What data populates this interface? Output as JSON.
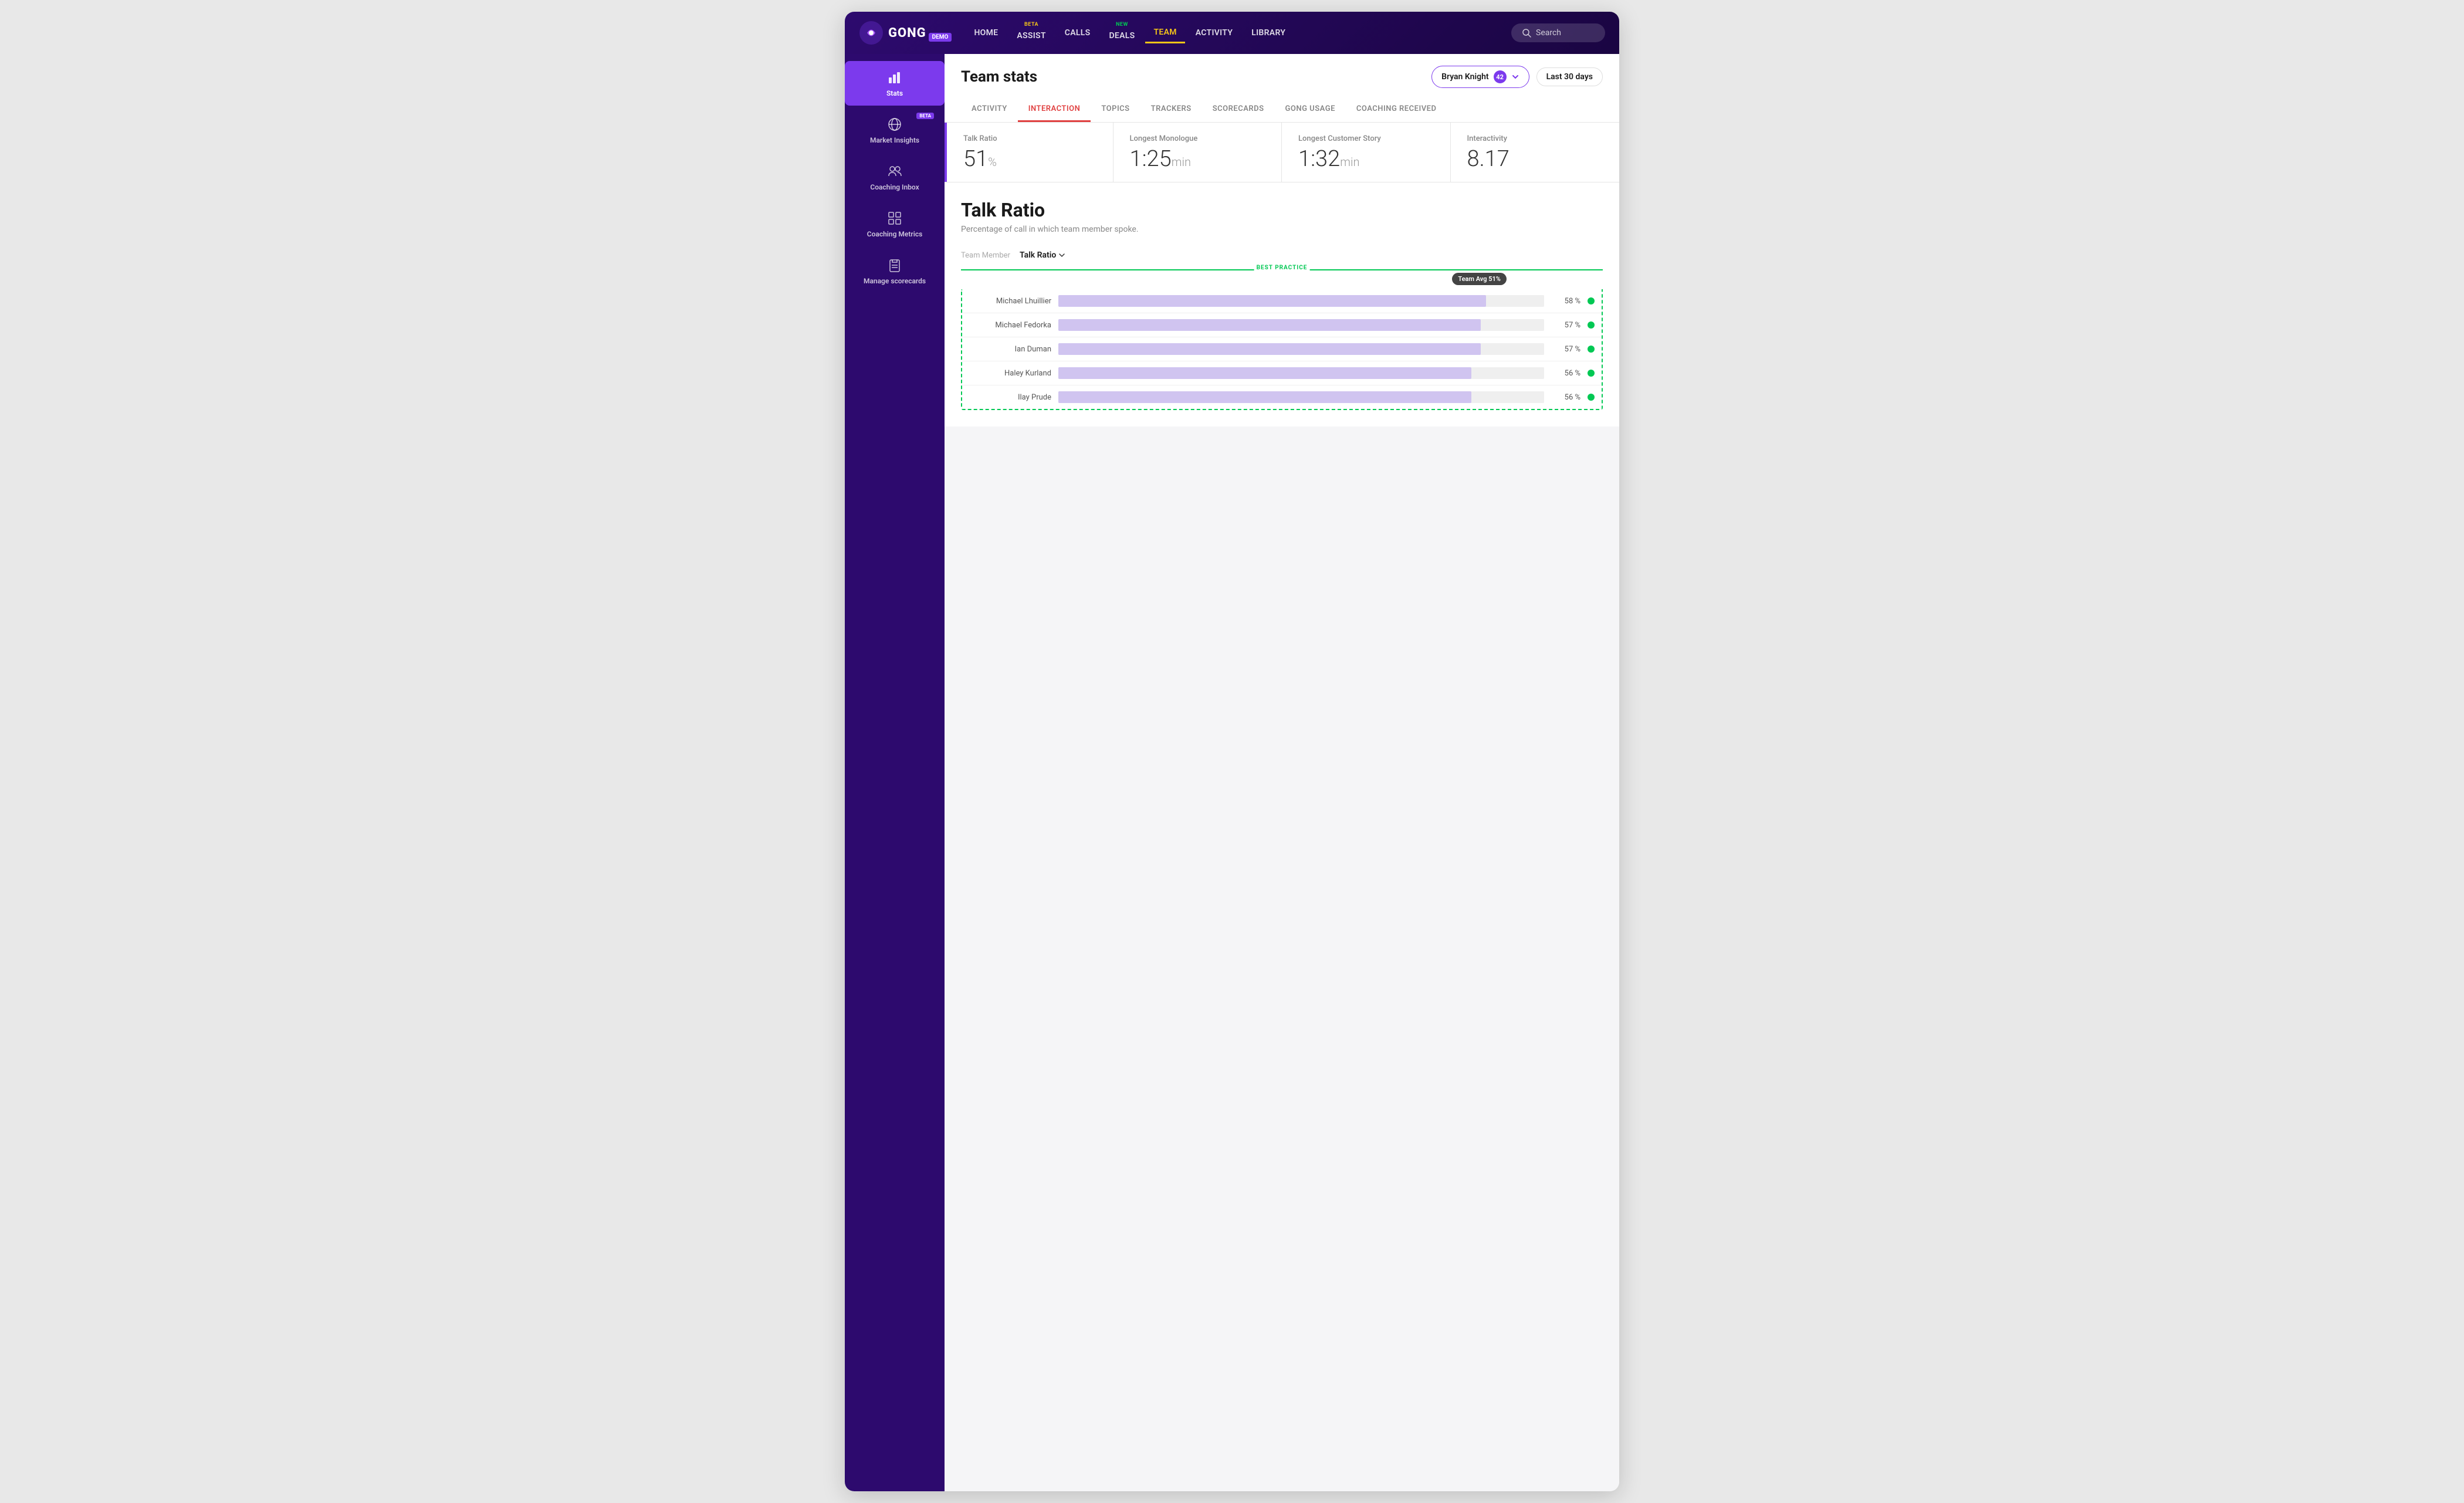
{
  "app": {
    "logo_text": "GONG",
    "demo_badge": "DEMO"
  },
  "nav": {
    "items": [
      {
        "id": "home",
        "label": "HOME",
        "badge": null,
        "active": false
      },
      {
        "id": "assist",
        "label": "ASSIST",
        "badge": "BETA",
        "active": false
      },
      {
        "id": "calls",
        "label": "CALLS",
        "badge": null,
        "active": false
      },
      {
        "id": "deals",
        "label": "DEALS",
        "badge": "NEW",
        "active": false
      },
      {
        "id": "team",
        "label": "TEAM",
        "badge": null,
        "active": true
      },
      {
        "id": "activity",
        "label": "ACTIVITY",
        "badge": null,
        "active": false
      },
      {
        "id": "library",
        "label": "LIBRARY",
        "badge": null,
        "active": false
      }
    ],
    "search_placeholder": "Search"
  },
  "sidebar": {
    "items": [
      {
        "id": "stats",
        "label": "Stats",
        "active": true,
        "badge": null,
        "icon": "bar-chart"
      },
      {
        "id": "market-insights",
        "label": "Market Insights",
        "active": false,
        "badge": "BETA",
        "icon": "globe"
      },
      {
        "id": "coaching-inbox",
        "label": "Coaching Inbox",
        "active": false,
        "badge": null,
        "icon": "people"
      },
      {
        "id": "coaching-metrics",
        "label": "Coaching Metrics",
        "active": false,
        "badge": null,
        "icon": "grid"
      },
      {
        "id": "manage-scorecards",
        "label": "Manage scorecards",
        "active": false,
        "badge": null,
        "icon": "clipboard"
      }
    ]
  },
  "header": {
    "title": "Team stats",
    "team_selector": {
      "name": "Bryan Knight",
      "count": "42"
    },
    "date_range": "Last 30 days"
  },
  "tabs": {
    "items": [
      {
        "id": "activity",
        "label": "ACTIVITY",
        "active": false
      },
      {
        "id": "interaction",
        "label": "INTERACTION",
        "active": true
      },
      {
        "id": "topics",
        "label": "TOPICS",
        "active": false
      },
      {
        "id": "trackers",
        "label": "TRACKERS",
        "active": false
      },
      {
        "id": "scorecards",
        "label": "SCORECARDS",
        "active": false
      },
      {
        "id": "gong-usage",
        "label": "GONG USAGE",
        "active": false
      },
      {
        "id": "coaching-received",
        "label": "COACHING RECEIVED",
        "active": false
      }
    ]
  },
  "stat_cards": [
    {
      "id": "talk-ratio",
      "label": "Talk Ratio",
      "value": "51",
      "unit": "%",
      "active": true
    },
    {
      "id": "longest-monologue",
      "label": "Longest Monologue",
      "value": "1:25",
      "unit": "min"
    },
    {
      "id": "longest-customer-story",
      "label": "Longest Customer Story",
      "value": "1:32",
      "unit": "min"
    },
    {
      "id": "interactivity",
      "label": "Interactivity",
      "value": "8.17",
      "unit": ""
    }
  ],
  "section": {
    "title": "Talk Ratio",
    "description": "Percentage of call in which team member spoke."
  },
  "chart": {
    "x_label": "Team Member",
    "sort_label": "Talk Ratio",
    "best_practice_label": "BEST PRACTICE",
    "team_avg_label": "Team Avg 51%",
    "team_avg_pct": 76,
    "rows": [
      {
        "name": "Michael Lhuillier",
        "value": "58 %",
        "pct": 88,
        "dot_color": "#00c853"
      },
      {
        "name": "Michael Fedorka",
        "value": "57 %",
        "pct": 87,
        "dot_color": "#00c853"
      },
      {
        "name": "Ian Duman",
        "value": "57 %",
        "pct": 87,
        "dot_color": "#00c853"
      },
      {
        "name": "Haley Kurland",
        "value": "56 %",
        "pct": 85,
        "dot_color": "#00c853"
      },
      {
        "name": "Ilay Prude",
        "value": "56 %",
        "pct": 85,
        "dot_color": "#00c853"
      }
    ]
  }
}
